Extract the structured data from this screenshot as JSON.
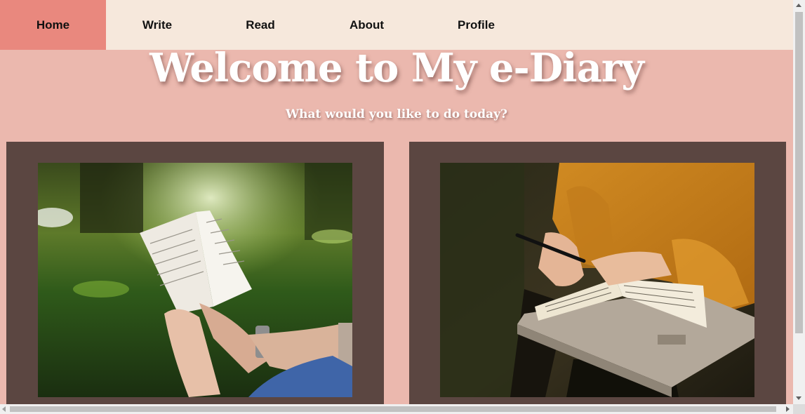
{
  "nav": {
    "items": [
      {
        "label": "Home",
        "active": true
      },
      {
        "label": "Write",
        "active": false
      },
      {
        "label": "Read",
        "active": false
      },
      {
        "label": "About",
        "active": false
      },
      {
        "label": "Profile",
        "active": false
      }
    ]
  },
  "hero": {
    "title": "Welcome to My e-Diary",
    "subtitle": "What would you like to do today?"
  },
  "cards": [
    {
      "image": "person-reading-book-outdoors-photo"
    },
    {
      "image": "person-writing-in-notebook-photo"
    }
  ],
  "colors": {
    "background": "#ebb8ae",
    "nav_background": "#f6e8dc",
    "nav_active": "#e9887e",
    "card_background": "#5b4641",
    "title_text": "#ffffff"
  }
}
